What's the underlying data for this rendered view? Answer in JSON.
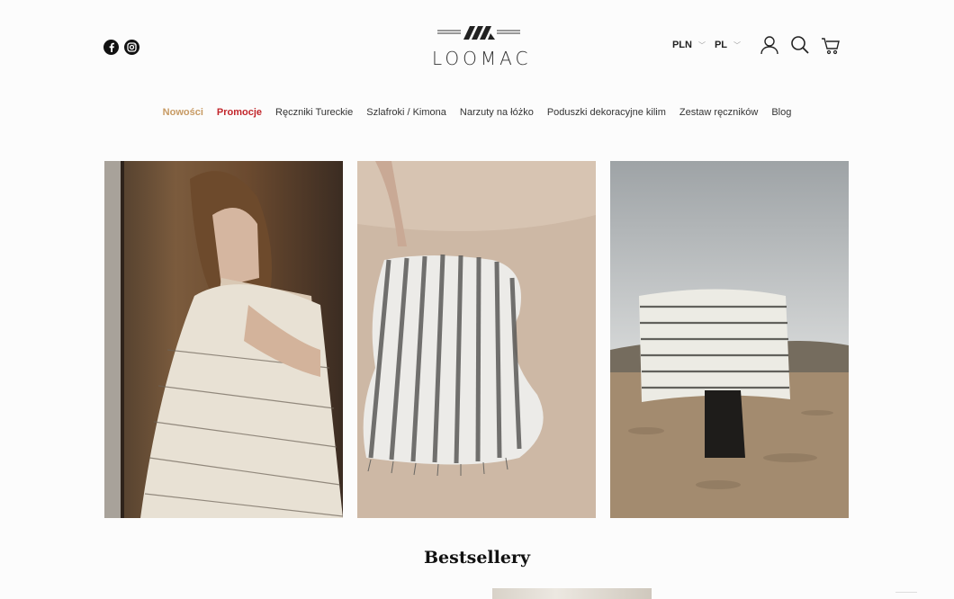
{
  "brand": {
    "name": "LOOMAC"
  },
  "social": [
    {
      "name": "facebook-icon"
    },
    {
      "name": "instagram-icon"
    }
  ],
  "header": {
    "currency": "PLN",
    "language": "PL",
    "icons": [
      "user-icon",
      "search-icon",
      "cart-icon"
    ]
  },
  "nav": {
    "items": [
      {
        "label": "Nowości"
      },
      {
        "label": "Promocje"
      },
      {
        "label": "Ręczniki Tureckie"
      },
      {
        "label": "Szlafroki / Kimona"
      },
      {
        "label": "Narzuty na łóżko"
      },
      {
        "label": "Poduszki dekoracyjne kilim"
      },
      {
        "label": "Zestaw ręczników"
      },
      {
        "label": "Blog"
      }
    ],
    "colors": {
      "new": "#c79a63",
      "promo": "#c2262b"
    }
  },
  "gallery": [
    {
      "name": "woman-wrapped-in-towel-photo"
    },
    {
      "name": "striped-towel-on-sand-photo"
    },
    {
      "name": "striped-towel-held-in-desert-photo"
    }
  ],
  "sections": {
    "bestsellers_title": "Bestsellery"
  }
}
